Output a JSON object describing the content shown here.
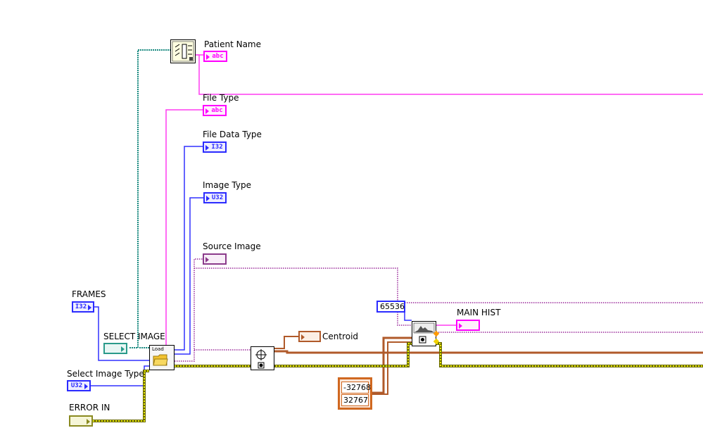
{
  "diagram": {
    "indicators": {
      "patient_name": {
        "label": "Patient Name",
        "type": "abc",
        "color": "#ff00ff"
      },
      "file_type": {
        "label": "File Type",
        "type": "abc",
        "color": "#ff00ff"
      },
      "file_data_type": {
        "label": "File Data Type",
        "type": "I32",
        "color": "#2b2bff"
      },
      "image_type": {
        "label": "Image Type",
        "type": "U32",
        "color": "#2b2bff"
      },
      "source_image": {
        "label": "Source Image",
        "type": "",
        "color": "#8b3b8b"
      },
      "centroid": {
        "label": "Centroid",
        "type": "",
        "color": "#b05a2a"
      },
      "main_hist": {
        "label": "MAIN HIST",
        "type": "",
        "color": "#ff00ff"
      }
    },
    "controls": {
      "frames": {
        "label": "FRAMES",
        "type": "I32",
        "color": "#2b2bff"
      },
      "select_image": {
        "label": "SELECT IMAGE",
        "type": "",
        "color": "#2a9a8a"
      },
      "select_image_type": {
        "label": "Select Image Type",
        "type": "U32",
        "color": "#2b2bff"
      },
      "error_in": {
        "label": "ERROR IN",
        "type": "",
        "color": "#8a8a20"
      }
    },
    "constants": {
      "hist_bins": "65536",
      "range_min": "-32768",
      "range_max": "32767"
    },
    "nodes": {
      "load_label": "Load"
    },
    "wire_colors": {
      "string": "#ff3cf0",
      "int": "#3030ff",
      "image": "#9a2a9a",
      "path": "#1a8a80",
      "cluster": "#b05a2a",
      "error": "#8a8a00"
    }
  }
}
